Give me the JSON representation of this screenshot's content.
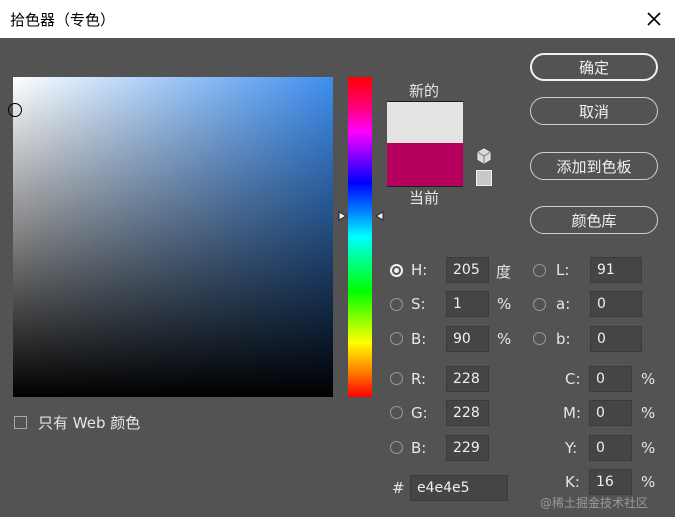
{
  "window": {
    "title": "拾色器（专色）"
  },
  "preview": {
    "new_label": "新的",
    "current_label": "当前",
    "new_color": "#e4e4e5",
    "current_color": "#b5005e"
  },
  "buttons": {
    "ok": "确定",
    "cancel": "取消",
    "add_to_swatches": "添加到色板",
    "color_libraries": "颜色库"
  },
  "hsb": {
    "h": {
      "label": "H:",
      "value": "205",
      "unit": "度"
    },
    "s": {
      "label": "S:",
      "value": "1",
      "unit": "%"
    },
    "b": {
      "label": "B:",
      "value": "90",
      "unit": "%"
    }
  },
  "rgb": {
    "r": {
      "label": "R:",
      "value": "228"
    },
    "g": {
      "label": "G:",
      "value": "228"
    },
    "b": {
      "label": "B:",
      "value": "229"
    }
  },
  "lab": {
    "l": {
      "label": "L:",
      "value": "91"
    },
    "a": {
      "label": "a:",
      "value": "0"
    },
    "b": {
      "label": "b:",
      "value": "0"
    }
  },
  "cmyk": {
    "c": {
      "label": "C:",
      "value": "0",
      "unit": "%"
    },
    "m": {
      "label": "M:",
      "value": "0",
      "unit": "%"
    },
    "y": {
      "label": "Y:",
      "value": "0",
      "unit": "%"
    },
    "k": {
      "label": "K:",
      "value": "16",
      "unit": "%"
    }
  },
  "hex": {
    "label": "#",
    "value": "e4e4e5"
  },
  "web_only": {
    "label": "只有 Web 颜色"
  },
  "watermark": "@稀土掘金技术社区"
}
